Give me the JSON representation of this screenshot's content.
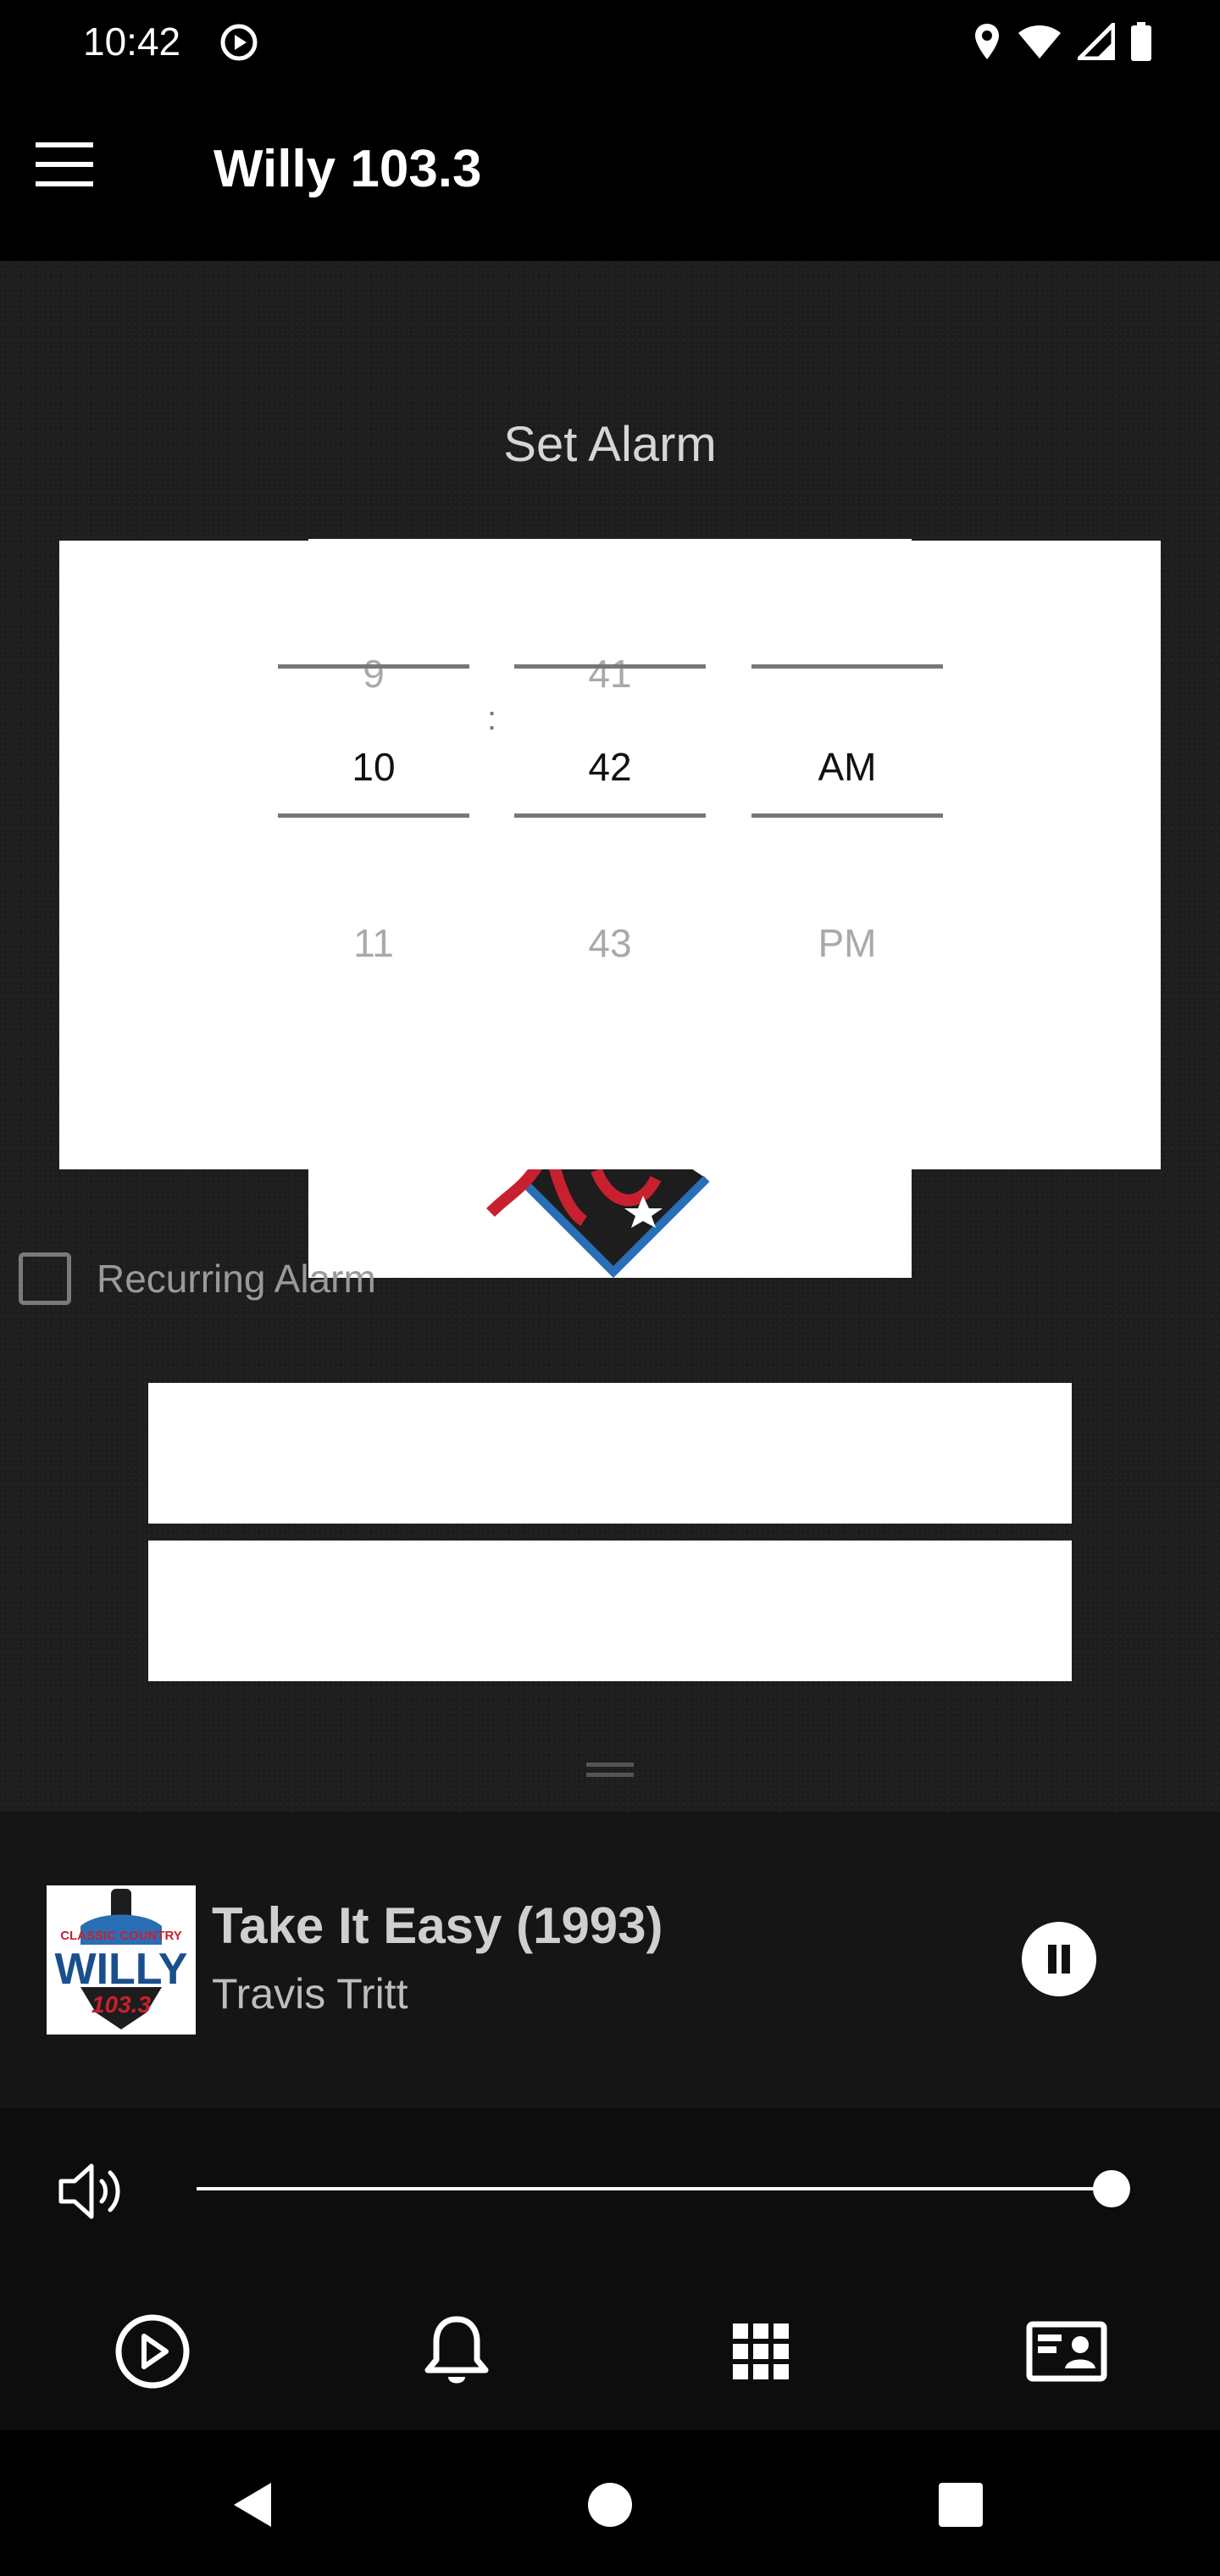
{
  "status_bar": {
    "time": "10:42",
    "icons": [
      "play-circle-icon",
      "location-icon",
      "wifi-icon",
      "signal-icon",
      "battery-icon"
    ]
  },
  "app_bar": {
    "title": "Willy 103.3",
    "menu_icon": "hamburger-menu-icon"
  },
  "alarm": {
    "heading": "Set Alarm",
    "picker": {
      "hour": {
        "prev": "9",
        "selected": "10",
        "next": "11"
      },
      "separator": ":",
      "minute": {
        "prev": "41",
        "selected": "42",
        "next": "43"
      },
      "period": {
        "prev": "",
        "selected": "AM",
        "next": "PM"
      }
    },
    "recurring": {
      "label": "Recurring Alarm",
      "checked": false
    },
    "buttons": [
      {
        "label": ""
      },
      {
        "label": ""
      }
    ]
  },
  "now_playing": {
    "album_art": {
      "line1": "CLASSIC COUNTRY",
      "line2": "WILLY",
      "line3": "103.3"
    },
    "title": "Take It Easy (1993)",
    "artist": "Travis Tritt",
    "state": "playing"
  },
  "volume": {
    "level": 1.0
  },
  "bottom_nav": [
    {
      "icon": "play-circle-icon"
    },
    {
      "icon": "bell-icon"
    },
    {
      "icon": "grid-icon"
    },
    {
      "icon": "contact-card-icon"
    }
  ],
  "system_nav": [
    "back-icon",
    "home-icon",
    "recents-icon"
  ],
  "colors": {
    "background": "#1e1e1e",
    "bar": "#000000",
    "logo_red": "#c8202f",
    "logo_blue": "#2a6fb6"
  }
}
